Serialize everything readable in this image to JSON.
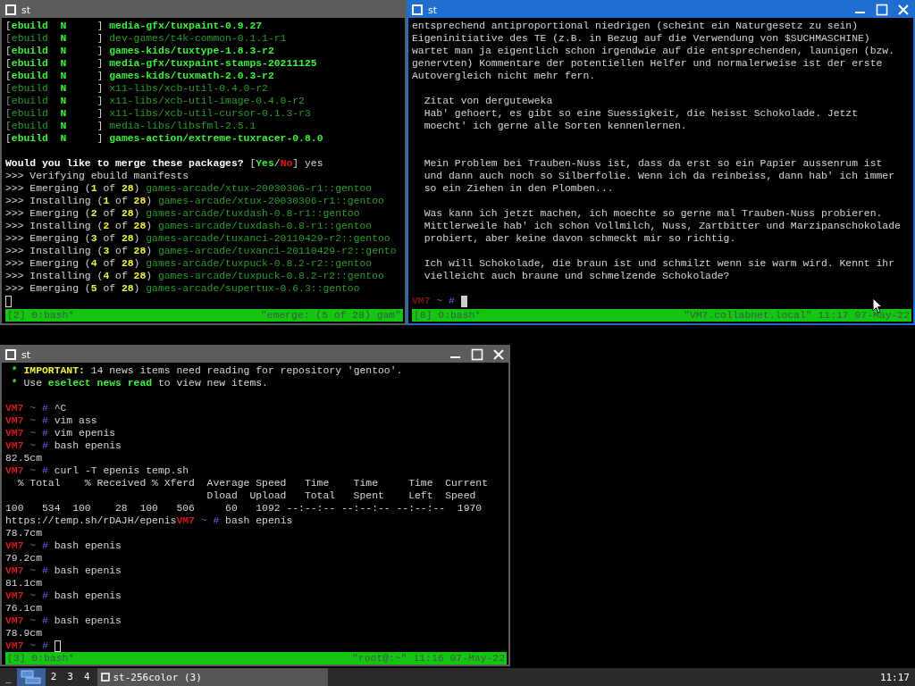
{
  "windows": [
    {
      "title": "st",
      "active": false,
      "controls": false,
      "lines": [
        {
          "kind": "text",
          "segments": [
            {
              "text": "[",
              "kind": "plain"
            },
            {
              "text": "ebuild",
              "kind": "accent"
            },
            {
              "text": "  N     ",
              "kind": "accent"
            },
            {
              "text": "] ",
              "kind": "plain"
            },
            {
              "text": "media-gfx/tuxpaint-0.9.27",
              "kind": "accent"
            }
          ]
        },
        {
          "kind": "text",
          "segments": [
            {
              "text": "[",
              "kind": "faint"
            },
            {
              "text": "ebuild",
              "kind": "muted"
            },
            {
              "text": "  N     ",
              "kind": "accent"
            },
            {
              "text": "] ",
              "kind": "plain"
            },
            {
              "text": "dev-games/t4k-common-0.1.1-r1",
              "kind": "muted"
            }
          ]
        },
        {
          "kind": "text",
          "segments": [
            {
              "text": "[",
              "kind": "plain"
            },
            {
              "text": "ebuild",
              "kind": "accent"
            },
            {
              "text": "  N     ",
              "kind": "accent"
            },
            {
              "text": "] ",
              "kind": "plain"
            },
            {
              "text": "games-kids/tuxtype-1.8.3-r2",
              "kind": "accent"
            }
          ]
        },
        {
          "kind": "text",
          "segments": [
            {
              "text": "[",
              "kind": "plain"
            },
            {
              "text": "ebuild",
              "kind": "accent"
            },
            {
              "text": "  N     ",
              "kind": "accent"
            },
            {
              "text": "] ",
              "kind": "plain"
            },
            {
              "text": "media-gfx/tuxpaint-stamps-20211125",
              "kind": "accent"
            }
          ]
        },
        {
          "kind": "text",
          "segments": [
            {
              "text": "[",
              "kind": "plain"
            },
            {
              "text": "ebuild",
              "kind": "accent"
            },
            {
              "text": "  N     ",
              "kind": "accent"
            },
            {
              "text": "] ",
              "kind": "plain"
            },
            {
              "text": "games-kids/tuxmath-2.0.3-r2",
              "kind": "accent"
            }
          ]
        },
        {
          "kind": "text",
          "segments": [
            {
              "text": "[",
              "kind": "faint"
            },
            {
              "text": "ebuild",
              "kind": "muted"
            },
            {
              "text": "  N     ",
              "kind": "accent"
            },
            {
              "text": "] ",
              "kind": "plain"
            },
            {
              "text": "x11-libs/xcb-util-0.4.0-r2",
              "kind": "muted"
            }
          ]
        },
        {
          "kind": "text",
          "segments": [
            {
              "text": "[",
              "kind": "faint"
            },
            {
              "text": "ebuild",
              "kind": "muted"
            },
            {
              "text": "  N     ",
              "kind": "accent"
            },
            {
              "text": "] ",
              "kind": "plain"
            },
            {
              "text": "x11-libs/xcb-util-image-0.4.0-r2",
              "kind": "muted"
            }
          ]
        },
        {
          "kind": "text",
          "segments": [
            {
              "text": "[",
              "kind": "faint"
            },
            {
              "text": "ebuild",
              "kind": "muted"
            },
            {
              "text": "  N     ",
              "kind": "accent"
            },
            {
              "text": "] ",
              "kind": "plain"
            },
            {
              "text": "x11-libs/xcb-util-cursor-0.1.3-r3",
              "kind": "muted"
            }
          ]
        },
        {
          "kind": "text",
          "segments": [
            {
              "text": "[",
              "kind": "faint"
            },
            {
              "text": "ebuild",
              "kind": "muted"
            },
            {
              "text": "  N     ",
              "kind": "accent"
            },
            {
              "text": "] ",
              "kind": "plain"
            },
            {
              "text": "media-libs/libsfml-2.5.1",
              "kind": "muted"
            }
          ]
        },
        {
          "kind": "text",
          "segments": [
            {
              "text": "[",
              "kind": "plain"
            },
            {
              "text": "ebuild",
              "kind": "accent"
            },
            {
              "text": "  N     ",
              "kind": "accent"
            },
            {
              "text": "] ",
              "kind": "plain"
            },
            {
              "text": "games-action/extreme-tuxracer-0.8.0",
              "kind": "accent"
            }
          ]
        },
        {
          "kind": "blank"
        },
        {
          "kind": "text",
          "segments": [
            {
              "text": "Would you like to merge these packages? ",
              "kind": "strong"
            },
            {
              "text": "[",
              "kind": "plain"
            },
            {
              "text": "Yes",
              "kind": "accent"
            },
            {
              "text": "/",
              "kind": "plain"
            },
            {
              "text": "No",
              "kind": "alert"
            },
            {
              "text": "] yes",
              "kind": "plain"
            }
          ]
        },
        {
          "kind": "text",
          "segments": [
            {
              "text": ">>> Verifying ebuild manifests",
              "kind": "plain"
            }
          ]
        },
        {
          "kind": "text",
          "segments": [
            {
              "text": ">>> Emerging (",
              "kind": "plain"
            },
            {
              "text": "1",
              "kind": "number"
            },
            {
              "text": " of ",
              "kind": "plain"
            },
            {
              "text": "28",
              "kind": "number"
            },
            {
              "text": ") ",
              "kind": "plain"
            },
            {
              "text": "games-arcade/xtux-20030306-r1::gentoo",
              "kind": "muted"
            }
          ]
        },
        {
          "kind": "text",
          "segments": [
            {
              "text": ">>> Installing (",
              "kind": "plain"
            },
            {
              "text": "1",
              "kind": "number"
            },
            {
              "text": " of ",
              "kind": "plain"
            },
            {
              "text": "28",
              "kind": "number"
            },
            {
              "text": ") ",
              "kind": "plain"
            },
            {
              "text": "games-arcade/xtux-20030306-r1::gentoo",
              "kind": "muted"
            }
          ]
        },
        {
          "kind": "text",
          "segments": [
            {
              "text": ">>> Emerging (",
              "kind": "plain"
            },
            {
              "text": "2",
              "kind": "number"
            },
            {
              "text": " of ",
              "kind": "plain"
            },
            {
              "text": "28",
              "kind": "number"
            },
            {
              "text": ") ",
              "kind": "plain"
            },
            {
              "text": "games-arcade/tuxdash-0.8-r1::gentoo",
              "kind": "muted"
            }
          ]
        },
        {
          "kind": "text",
          "segments": [
            {
              "text": ">>> Installing (",
              "kind": "plain"
            },
            {
              "text": "2",
              "kind": "number"
            },
            {
              "text": " of ",
              "kind": "plain"
            },
            {
              "text": "28",
              "kind": "number"
            },
            {
              "text": ") ",
              "kind": "plain"
            },
            {
              "text": "games-arcade/tuxdash-0.8-r1::gentoo",
              "kind": "muted"
            }
          ]
        },
        {
          "kind": "text",
          "segments": [
            {
              "text": ">>> Emerging (",
              "kind": "plain"
            },
            {
              "text": "3",
              "kind": "number"
            },
            {
              "text": " of ",
              "kind": "plain"
            },
            {
              "text": "28",
              "kind": "number"
            },
            {
              "text": ") ",
              "kind": "plain"
            },
            {
              "text": "games-arcade/tuxanci-20110429-r2::gentoo",
              "kind": "muted"
            }
          ]
        },
        {
          "kind": "text",
          "segments": [
            {
              "text": ">>> Installing (",
              "kind": "plain"
            },
            {
              "text": "3",
              "kind": "number"
            },
            {
              "text": " of ",
              "kind": "plain"
            },
            {
              "text": "28",
              "kind": "number"
            },
            {
              "text": ") ",
              "kind": "plain"
            },
            {
              "text": "games-arcade/tuxanci-20110429-r2::gento",
              "kind": "muted"
            }
          ]
        },
        {
          "kind": "text",
          "segments": [
            {
              "text": ">>> Emerging (",
              "kind": "plain"
            },
            {
              "text": "4",
              "kind": "number"
            },
            {
              "text": " of ",
              "kind": "plain"
            },
            {
              "text": "28",
              "kind": "number"
            },
            {
              "text": ") ",
              "kind": "plain"
            },
            {
              "text": "games-arcade/tuxpuck-0.8.2-r2::gentoo",
              "kind": "muted"
            }
          ]
        },
        {
          "kind": "text",
          "segments": [
            {
              "text": ">>> Installing (",
              "kind": "plain"
            },
            {
              "text": "4",
              "kind": "number"
            },
            {
              "text": " of ",
              "kind": "plain"
            },
            {
              "text": "28",
              "kind": "number"
            },
            {
              "text": ") ",
              "kind": "plain"
            },
            {
              "text": "games-arcade/tuxpuck-0.8.2-r2::gentoo",
              "kind": "muted"
            }
          ]
        },
        {
          "kind": "text",
          "segments": [
            {
              "text": ">>> Emerging (",
              "kind": "plain"
            },
            {
              "text": "5",
              "kind": "number"
            },
            {
              "text": " of ",
              "kind": "plain"
            },
            {
              "text": "28",
              "kind": "number"
            },
            {
              "text": ") ",
              "kind": "plain"
            },
            {
              "text": "games-arcade/supertux-0.6.3::gentoo",
              "kind": "muted"
            }
          ]
        },
        {
          "kind": "text",
          "cursor": true
        }
      ],
      "status": {
        "left": "[2] 0:bash*",
        "right": "\"emerge: (5 of 28) gam\""
      }
    },
    {
      "title": "st",
      "active": true,
      "controls": true,
      "lines": [
        {
          "kind": "text",
          "segments": [
            {
              "text": "entsprechend antiproportional niedrigen (scheint ein Naturgesetz zu sein)",
              "kind": "plain"
            }
          ]
        },
        {
          "kind": "text",
          "segments": [
            {
              "text": "Eigeninitiative des TE (z.B. in Bezug auf die Verwendung von $SUCHMASCHINE)",
              "kind": "plain"
            }
          ]
        },
        {
          "kind": "text",
          "segments": [
            {
              "text": "wartet man ja eigentlich schon irgendwie auf die entsprechenden, launigen (bzw.",
              "kind": "plain"
            }
          ]
        },
        {
          "kind": "text",
          "segments": [
            {
              "text": "genervten) Kommentare der potentiellen Helfer und normalerweise ist der erste",
              "kind": "plain"
            }
          ]
        },
        {
          "kind": "text",
          "segments": [
            {
              "text": "Autovergleich nicht mehr fern.",
              "kind": "plain"
            }
          ]
        },
        {
          "kind": "blank"
        },
        {
          "kind": "text",
          "segments": [
            {
              "text": "  Zitat von derguteweka",
              "kind": "plain"
            }
          ]
        },
        {
          "kind": "text",
          "segments": [
            {
              "text": "  Hab' gehoert, es gibt so eine Suessigkeit, die heisst Schokolade. Jetzt",
              "kind": "plain"
            }
          ]
        },
        {
          "kind": "text",
          "segments": [
            {
              "text": "  moecht' ich gerne alle Sorten kennenlernen.",
              "kind": "plain"
            }
          ]
        },
        {
          "kind": "blank"
        },
        {
          "kind": "blank"
        },
        {
          "kind": "text",
          "segments": [
            {
              "text": "  Mein Problem bei Trauben-Nuss ist, dass da erst so ein Papier aussenrum ist",
              "kind": "plain"
            }
          ]
        },
        {
          "kind": "text",
          "segments": [
            {
              "text": "  und dann auch noch so Silberfolie. Wenn ich da reinbeiss, dann hab' ich immer",
              "kind": "plain"
            }
          ]
        },
        {
          "kind": "text",
          "segments": [
            {
              "text": "  so ein Ziehen in den Plomben...",
              "kind": "plain"
            }
          ]
        },
        {
          "kind": "blank"
        },
        {
          "kind": "text",
          "segments": [
            {
              "text": "  Was kann ich jetzt machen, ich moechte so gerne mal Trauben-Nuss probieren.",
              "kind": "plain"
            }
          ]
        },
        {
          "kind": "text",
          "segments": [
            {
              "text": "  Mittlerweile hab' ich schon Vollmilch, Nuss, Zartbitter und Marzipanschokolade",
              "kind": "plain"
            }
          ]
        },
        {
          "kind": "text",
          "segments": [
            {
              "text": "  probiert, aber keine davon schmeckt mir so richtig.",
              "kind": "plain"
            }
          ]
        },
        {
          "kind": "blank"
        },
        {
          "kind": "text",
          "segments": [
            {
              "text": "  Ich will Schokolade, die braun ist und schmilzt wenn sie warm wird. Kennt ihr",
              "kind": "plain"
            }
          ]
        },
        {
          "kind": "text",
          "segments": [
            {
              "text": "  vielleicht auch braune und schmelzende Schokolade?",
              "kind": "plain"
            }
          ]
        },
        {
          "kind": "blank"
        },
        {
          "kind": "text",
          "segments": [
            {
              "text": "VM7",
              "kind": "prompt-dim"
            },
            {
              "text": " ~ ",
              "kind": "tilde"
            },
            {
              "text": "# ",
              "kind": "hash"
            }
          ],
          "cursor": true
        }
      ],
      "status": {
        "left": "[8] 0:bash*",
        "right": "\"VM7.collabnet.local\" 11:17 07-May-22"
      }
    },
    {
      "title": "st",
      "active": false,
      "controls": true,
      "lines": [
        {
          "kind": "text",
          "segments": [
            {
              "text": " * ",
              "kind": "accent"
            },
            {
              "text": "IMPORTANT:",
              "kind": "number"
            },
            {
              "text": " 14 news items need reading for repository 'gentoo'.",
              "kind": "plain"
            }
          ]
        },
        {
          "kind": "text",
          "segments": [
            {
              "text": " * ",
              "kind": "accent"
            },
            {
              "text": "Use ",
              "kind": "plain"
            },
            {
              "text": "eselect news read",
              "kind": "accent"
            },
            {
              "text": " to view new items.",
              "kind": "plain"
            }
          ]
        },
        {
          "kind": "blank"
        },
        {
          "kind": "text",
          "segments": [
            {
              "text": "VM7",
              "kind": "prompt"
            },
            {
              "text": " ~ ",
              "kind": "tilde"
            },
            {
              "text": "# ",
              "kind": "hash"
            },
            {
              "text": "^C",
              "kind": "plain"
            }
          ]
        },
        {
          "kind": "text",
          "segments": [
            {
              "text": "VM7",
              "kind": "prompt"
            },
            {
              "text": " ~ ",
              "kind": "tilde"
            },
            {
              "text": "# ",
              "kind": "hash"
            },
            {
              "text": "vim ass",
              "kind": "plain"
            }
          ]
        },
        {
          "kind": "text",
          "segments": [
            {
              "text": "VM7",
              "kind": "prompt"
            },
            {
              "text": " ~ ",
              "kind": "tilde"
            },
            {
              "text": "# ",
              "kind": "hash"
            },
            {
              "text": "vim epenis",
              "kind": "plain"
            }
          ]
        },
        {
          "kind": "text",
          "segments": [
            {
              "text": "VM7",
              "kind": "prompt"
            },
            {
              "text": " ~ ",
              "kind": "tilde"
            },
            {
              "text": "# ",
              "kind": "hash"
            },
            {
              "text": "bash epenis",
              "kind": "plain"
            }
          ]
        },
        {
          "kind": "text",
          "segments": [
            {
              "text": "82.5cm",
              "kind": "plain"
            }
          ]
        },
        {
          "kind": "text",
          "segments": [
            {
              "text": "VM7",
              "kind": "prompt"
            },
            {
              "text": " ~ ",
              "kind": "tilde"
            },
            {
              "text": "# ",
              "kind": "hash"
            },
            {
              "text": "curl -T epenis temp.sh",
              "kind": "plain"
            }
          ]
        },
        {
          "kind": "text",
          "segments": [
            {
              "text": "  % Total    % Received % Xferd  Average Speed   Time    Time     Time  Current",
              "kind": "plain"
            }
          ]
        },
        {
          "kind": "text",
          "segments": [
            {
              "text": "                                 Dload  Upload   Total   Spent    Left  Speed",
              "kind": "plain"
            }
          ]
        },
        {
          "kind": "text",
          "segments": [
            {
              "text": "100   534  100    28  100   506     60   1092 --:--:-- --:--:-- --:--:--  1970",
              "kind": "plain"
            }
          ]
        },
        {
          "kind": "text",
          "segments": [
            {
              "text": "https://temp.sh/rDAJH/epenis",
              "kind": "plain"
            },
            {
              "text": "VM7",
              "kind": "prompt"
            },
            {
              "text": " ~ ",
              "kind": "tilde"
            },
            {
              "text": "# ",
              "kind": "hash"
            },
            {
              "text": "bash epenis",
              "kind": "plain"
            }
          ]
        },
        {
          "kind": "text",
          "segments": [
            {
              "text": "78.7cm",
              "kind": "plain"
            }
          ]
        },
        {
          "kind": "text",
          "segments": [
            {
              "text": "VM7",
              "kind": "prompt"
            },
            {
              "text": " ~ ",
              "kind": "tilde"
            },
            {
              "text": "# ",
              "kind": "hash"
            },
            {
              "text": "bash epenis",
              "kind": "plain"
            }
          ]
        },
        {
          "kind": "text",
          "segments": [
            {
              "text": "79.2cm",
              "kind": "plain"
            }
          ]
        },
        {
          "kind": "text",
          "segments": [
            {
              "text": "VM7",
              "kind": "prompt"
            },
            {
              "text": " ~ ",
              "kind": "tilde"
            },
            {
              "text": "# ",
              "kind": "hash"
            },
            {
              "text": "bash epenis",
              "kind": "plain"
            }
          ]
        },
        {
          "kind": "text",
          "segments": [
            {
              "text": "81.1cm",
              "kind": "plain"
            }
          ]
        },
        {
          "kind": "text",
          "segments": [
            {
              "text": "VM7",
              "kind": "prompt"
            },
            {
              "text": " ~ ",
              "kind": "tilde"
            },
            {
              "text": "# ",
              "kind": "hash"
            },
            {
              "text": "bash epenis",
              "kind": "plain"
            }
          ]
        },
        {
          "kind": "text",
          "segments": [
            {
              "text": "76.1cm",
              "kind": "plain"
            }
          ]
        },
        {
          "kind": "text",
          "segments": [
            {
              "text": "VM7",
              "kind": "prompt"
            },
            {
              "text": " ~ ",
              "kind": "tilde"
            },
            {
              "text": "# ",
              "kind": "hash"
            },
            {
              "text": "bash epenis",
              "kind": "plain"
            }
          ]
        },
        {
          "kind": "text",
          "segments": [
            {
              "text": "78.9cm",
              "kind": "plain"
            }
          ]
        },
        {
          "kind": "text",
          "segments": [
            {
              "text": "VM7",
              "kind": "prompt"
            },
            {
              "text": " ~ ",
              "kind": "tilde"
            },
            {
              "text": "# ",
              "kind": "hash"
            }
          ],
          "cursor": true
        }
      ],
      "status": {
        "left": "[3] 0:bash*",
        "right": "\"root@:~\" 11:16 07-May-22"
      }
    }
  ],
  "taskbar": {
    "menu_label": "_",
    "workspaces": [
      {
        "kind": "pager",
        "selected": true
      },
      {
        "kind": "number",
        "label": "2",
        "selected": false
      },
      {
        "kind": "number",
        "label": "3",
        "selected": false
      },
      {
        "kind": "number",
        "label": "4",
        "selected": false
      }
    ],
    "tasks": [
      {
        "label": "st-256color (3)"
      }
    ],
    "clock": "11:17"
  }
}
